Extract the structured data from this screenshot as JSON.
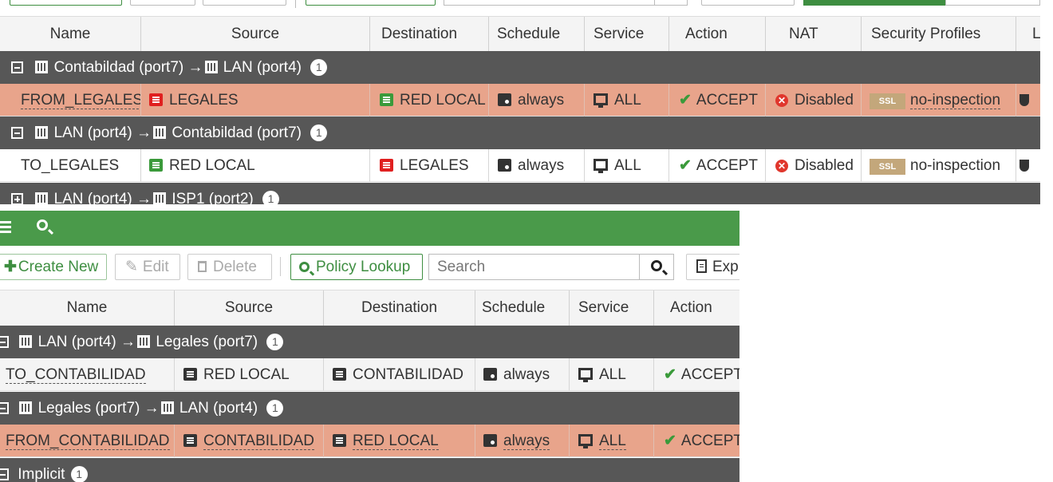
{
  "top": {
    "columns": [
      "Name",
      "Source",
      "Destination",
      "Schedule",
      "Service",
      "Action",
      "NAT",
      "Security Profiles",
      "Log"
    ],
    "groups": [
      {
        "label_from": "Contabildad (port7)",
        "arrow": "→",
        "label_to": "LAN (port4)",
        "count": "1",
        "expanded": true,
        "policy": {
          "name": "FROM_LEGALES",
          "source": "LEGALES",
          "destination": "RED LOCAL",
          "schedule": "always",
          "service": "ALL",
          "action": "ACCEPT",
          "nat": "Disabled",
          "ssl_badge": "SSL",
          "profile": "no-inspection",
          "selected": true
        }
      },
      {
        "label_from": "LAN (port4)",
        "arrow": "→",
        "label_to": "Contabildad (port7)",
        "count": "1",
        "expanded": true,
        "policy": {
          "name": "TO_LEGALES",
          "source": "RED LOCAL",
          "destination": "LEGALES",
          "schedule": "always",
          "service": "ALL",
          "action": "ACCEPT",
          "nat": "Disabled",
          "ssl_badge": "SSL",
          "profile": "no-inspection",
          "selected": false
        }
      },
      {
        "label_from": "LAN (port4)",
        "arrow": "→",
        "label_to": "ISP1 (port2)",
        "count": "1",
        "expanded": false
      }
    ]
  },
  "bottom": {
    "toolbar": {
      "create_new": "Create New",
      "edit": "Edit",
      "delete": "Delete",
      "policy_lookup": "Policy Lookup",
      "search_placeholder": "Search",
      "export": "Exp"
    },
    "columns": [
      "Name",
      "Source",
      "Destination",
      "Schedule",
      "Service",
      "Action"
    ],
    "groups": [
      {
        "label_from": "LAN (port4)",
        "arrow": "→",
        "label_to": "Legales (port7)",
        "count": "1",
        "policy": {
          "name": "TO_CONTABILIDAD",
          "source": "RED LOCAL",
          "destination": "CONTABILIDAD",
          "schedule": "always",
          "service": "ALL",
          "action": "ACCEPT",
          "selected": false
        }
      },
      {
        "label_from": "Legales (port7)",
        "arrow": "→",
        "label_to": "LAN (port4)",
        "count": "1",
        "policy": {
          "name": "FROM_CONTABILIDAD",
          "source": "CONTABILIDAD",
          "destination": "RED LOCAL",
          "schedule": "always",
          "service": "ALL",
          "action": "ACCEPT",
          "selected": true
        }
      },
      {
        "label": "Implicit",
        "count": "1"
      }
    ]
  },
  "colors": {
    "green_bar": "#4a9a4a",
    "group_row": "#575757",
    "selected_row": "#e8a48b",
    "address_red": "#e02020",
    "address_green": "#3a9a3a",
    "ssl_badge": "#c3a77b"
  }
}
